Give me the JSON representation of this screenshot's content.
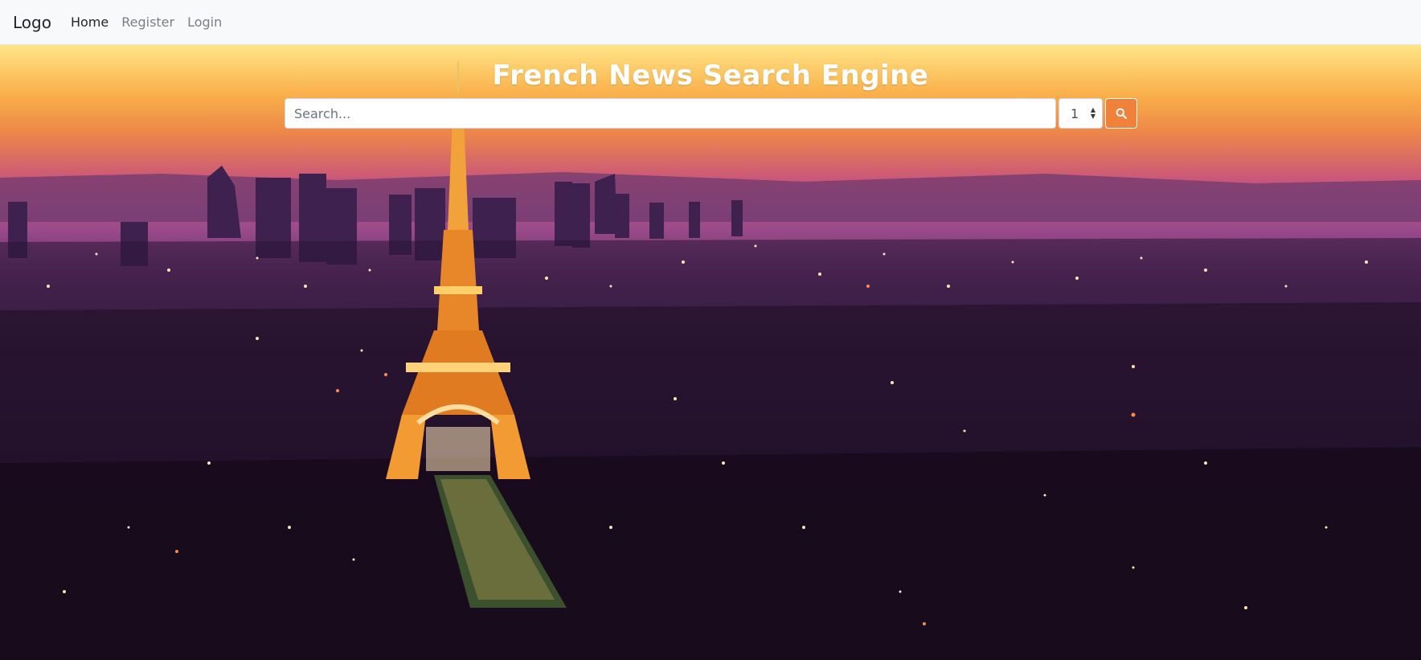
{
  "navbar": {
    "brand": "Logo",
    "links": [
      {
        "label": "Home",
        "active": true
      },
      {
        "label": "Register",
        "active": false
      },
      {
        "label": "Login",
        "active": false
      }
    ]
  },
  "hero": {
    "title": "French News Search Engine",
    "background": "Paris skyline at dusk with illuminated Eiffel Tower"
  },
  "search": {
    "placeholder": "Search...",
    "value": "",
    "count_selected": "1",
    "button_icon": "search-icon",
    "button_color": "#f0813a"
  }
}
